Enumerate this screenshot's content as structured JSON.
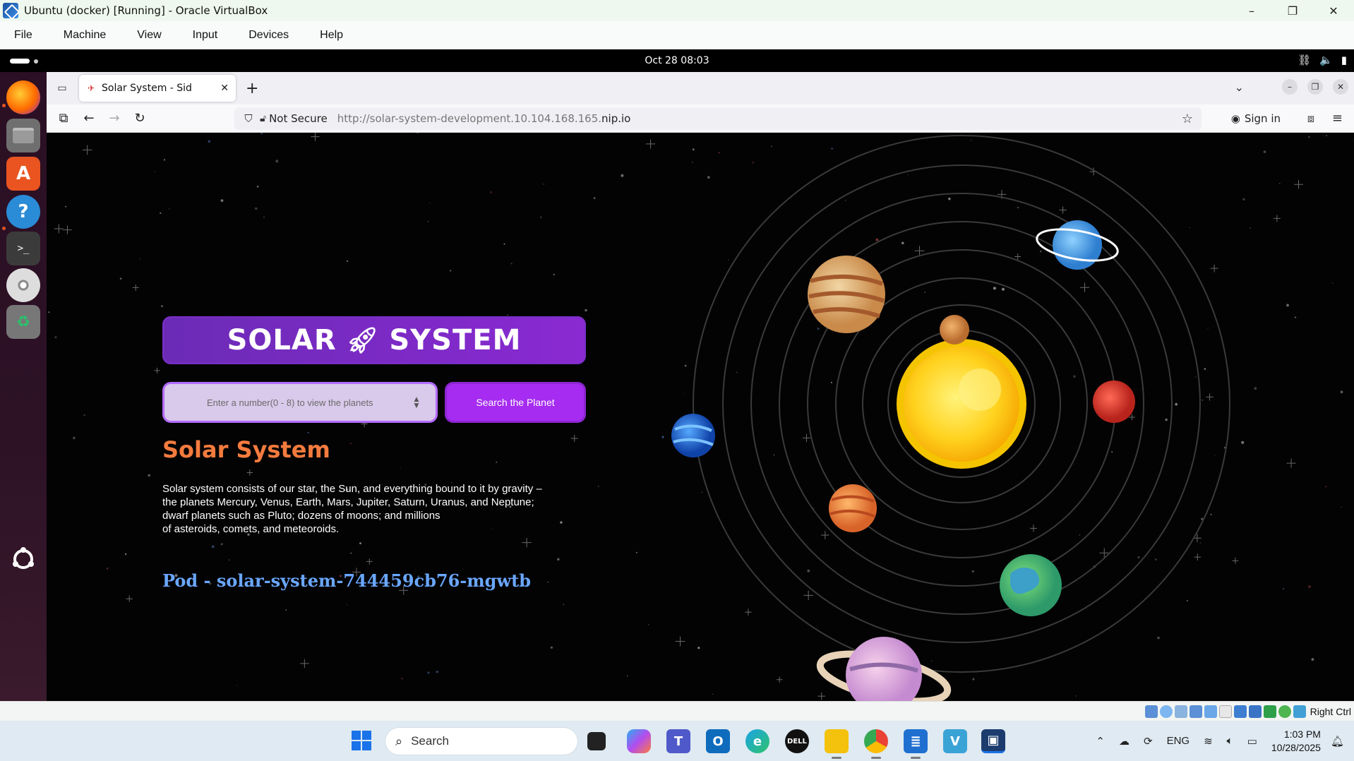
{
  "vbox": {
    "title": "Ubuntu (docker) [Running] - Oracle VirtualBox",
    "menu": [
      "File",
      "Machine",
      "View",
      "Input",
      "Devices",
      "Help"
    ],
    "controls": {
      "minimize": "–",
      "restore": "❐",
      "close": "✕"
    }
  },
  "gnome": {
    "clock": "Oct 28  08:03",
    "sys_icons": [
      "network-icon",
      "volume-icon",
      "battery-icon"
    ]
  },
  "dock": {
    "apps": [
      "firefox-icon",
      "files-icon",
      "app-center-icon",
      "help-icon",
      "terminal-icon",
      "disc-icon",
      "trash-icon",
      "show-apps-icon"
    ]
  },
  "firefox": {
    "tab_title": "Solar System - Sid",
    "not_secure": "Not Secure",
    "url_prefix": "http://solar-system-development.10.104.168.165.",
    "url_domain": "nip.io",
    "sign_in": "Sign in"
  },
  "page": {
    "brand_left": "SOLAR",
    "brand_right": "SYSTEM",
    "input_placeholder": "Enter a number(0 - 8) to view the planets",
    "search_button": "Search the Planet",
    "heading": "Solar System",
    "description_lines": [
      "Solar system consists of our star, the Sun, and everything bound to it by gravity –",
      "the planets Mercury, Venus, Earth, Mars, Jupiter, Saturn, Uranus, and Neptune;",
      "dwarf planets such as Pluto; dozens of moons; and millions",
      "of asteroids, comets, and meteoroids."
    ],
    "pod": "Pod - solar-system-744459cb76-mgwtb"
  },
  "vm_status": {
    "host_key": "Right Ctrl"
  },
  "taskbar": {
    "search_label": "Search",
    "lang": "ENG",
    "time": "1:03 PM",
    "date": "10/28/2025"
  },
  "colors": {
    "brand_gradient_start": "#6b2bb6",
    "brand_gradient_end": "#8a2ad2",
    "heading": "#f47b3e",
    "pod": "#6aa7ff",
    "button": "#a52cf0"
  }
}
